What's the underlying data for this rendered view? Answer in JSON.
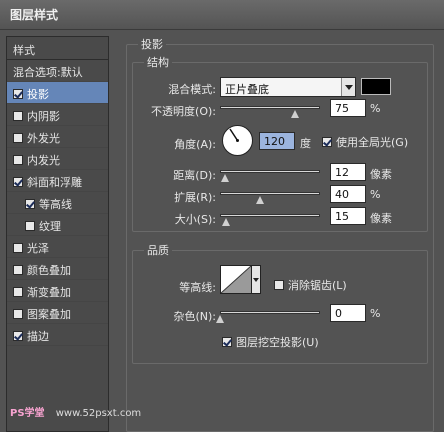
{
  "window": {
    "title": "图层样式"
  },
  "sidebar": {
    "header": "样式",
    "items": [
      {
        "label": "混合选项:默认",
        "has_checkbox": false,
        "checked": false,
        "selected": false,
        "indent": false
      },
      {
        "label": "投影",
        "has_checkbox": true,
        "checked": true,
        "selected": true,
        "indent": false
      },
      {
        "label": "内阴影",
        "has_checkbox": true,
        "checked": false,
        "selected": false,
        "indent": false
      },
      {
        "label": "外发光",
        "has_checkbox": true,
        "checked": false,
        "selected": false,
        "indent": false
      },
      {
        "label": "内发光",
        "has_checkbox": true,
        "checked": false,
        "selected": false,
        "indent": false
      },
      {
        "label": "斜面和浮雕",
        "has_checkbox": true,
        "checked": true,
        "selected": false,
        "indent": false
      },
      {
        "label": "等高线",
        "has_checkbox": true,
        "checked": true,
        "selected": false,
        "indent": true
      },
      {
        "label": "纹理",
        "has_checkbox": true,
        "checked": false,
        "selected": false,
        "indent": true
      },
      {
        "label": "光泽",
        "has_checkbox": true,
        "checked": false,
        "selected": false,
        "indent": false
      },
      {
        "label": "颜色叠加",
        "has_checkbox": true,
        "checked": false,
        "selected": false,
        "indent": false
      },
      {
        "label": "渐变叠加",
        "has_checkbox": true,
        "checked": false,
        "selected": false,
        "indent": false
      },
      {
        "label": "图案叠加",
        "has_checkbox": true,
        "checked": false,
        "selected": false,
        "indent": false
      },
      {
        "label": "描边",
        "has_checkbox": true,
        "checked": true,
        "selected": false,
        "indent": false
      }
    ]
  },
  "drop_shadow": {
    "title": "投影",
    "structure": {
      "title": "结构",
      "blend_mode_label": "混合模式:",
      "blend_mode_value": "正片叠底",
      "shadow_color": "#000000",
      "opacity_label": "不透明度(O):",
      "opacity_value": "75",
      "opacity_unit": "%",
      "opacity_level": 0.75,
      "angle_label": "角度(A):",
      "angle_value": "120",
      "angle_unit": "度",
      "global_light_label": "使用全局光(G)",
      "global_light_checked": true,
      "distance_label": "距离(D):",
      "distance_value": "12",
      "distance_unit": "像素",
      "distance_level": 0.05,
      "spread_label": "扩展(R):",
      "spread_value": "40",
      "spread_unit": "%",
      "spread_level": 0.4,
      "size_label": "大小(S):",
      "size_value": "15",
      "size_unit": "像素",
      "size_level": 0.06
    },
    "quality": {
      "title": "品质",
      "contour_label": "等高线:",
      "anti_aliased_label": "消除锯齿(L)",
      "anti_aliased_checked": false,
      "noise_label": "杂色(N):",
      "noise_value": "0",
      "noise_unit": "%",
      "noise_level": 0.0
    },
    "knockout_label": "图层挖空投影(U)",
    "knockout_checked": true
  },
  "watermark": {
    "left": "PS学堂",
    "right": "www.52psxt.com"
  }
}
